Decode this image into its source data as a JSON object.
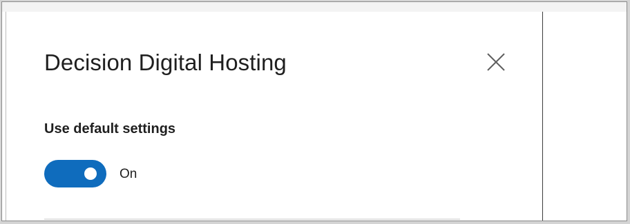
{
  "panel": {
    "title": "Decision Digital Hosting",
    "close_icon": "close-icon"
  },
  "settings": {
    "heading": "Use default settings",
    "toggle": {
      "state_label": "On",
      "checked": true,
      "accent_color": "#0f6cbd"
    }
  }
}
